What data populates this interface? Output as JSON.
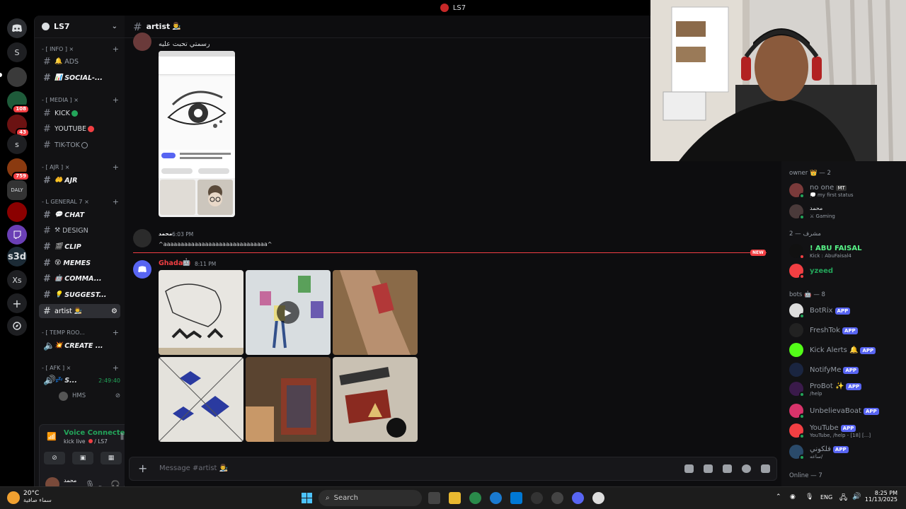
{
  "window": {
    "title": "LS7"
  },
  "rail": {
    "servers": [
      {
        "name": "discord-home-icon",
        "label": "",
        "badge": ""
      },
      {
        "name": "server-s-1",
        "label": "S",
        "badge": ""
      },
      {
        "name": "server-a",
        "label": "",
        "badge": ""
      },
      {
        "name": "server-b",
        "label": "",
        "badge": "108"
      },
      {
        "name": "server-c",
        "label": "",
        "badge": "43"
      },
      {
        "name": "server-s-2",
        "label": "s",
        "badge": ""
      },
      {
        "name": "server-d",
        "label": "",
        "badge": "759"
      },
      {
        "name": "server-daly",
        "label": "DALY",
        "badge": ""
      },
      {
        "name": "server-e",
        "label": "",
        "badge": ""
      },
      {
        "name": "server-twitch",
        "label": "",
        "badge": ""
      },
      {
        "name": "server-s3d",
        "label": "s3d",
        "badge": ""
      },
      {
        "name": "server-xs",
        "label": "Xs",
        "badge": ""
      }
    ]
  },
  "guild": {
    "name": "LS7"
  },
  "sidebar": {
    "categories": [
      {
        "label": "- [ INFO ] ×",
        "top": 0
      },
      {
        "label": "- [ MEDIA ] ×",
        "top": 0
      },
      {
        "label": "- [ AJR ] ×",
        "top": 0
      },
      {
        "label": "- L GENERAL 7 ×",
        "top": 0
      },
      {
        "label": "- [ TEMP ROO...",
        "top": 0
      },
      {
        "label": "- [ AFK ] ×",
        "top": 0
      }
    ],
    "channels": {
      "ads": "ADS",
      "social": "SOCIAL-...",
      "kick": "KICK",
      "youtube": "YOUTUBE",
      "tiktok": "TIK-TOK",
      "ajr": "AJR",
      "chat": "CHAT",
      "design": "DESIGN",
      "clip": "CLIP",
      "memes": "MEMES",
      "commands": "COMMA...",
      "suggest": "SUGGEST...",
      "artist": "artist",
      "create": "CREATE ...",
      "afk_voice": "S...",
      "afk_time": "2:49:40",
      "afk_user": "HMS"
    }
  },
  "voice": {
    "status": "Voice Connected",
    "channel": "kick live",
    "guild": "/ LS7"
  },
  "user": {
    "name": "محمد"
  },
  "channel": {
    "name": "artist"
  },
  "messages": [
    {
      "text": "رسمتي تحبت عليه"
    },
    {
      "author": "محمد",
      "time": "6:03 PM",
      "text": "^aaaaaaaaaaaaaaaaaaaaaaaaaaaaaa^"
    },
    {
      "author": "Ghada",
      "time": "8:11 PM"
    }
  ],
  "new_label": "NEW",
  "composer": {
    "placeholder": "Message #artist"
  },
  "members": {
    "groups": {
      "owner": "owner 👑 — 2",
      "mod": "2 — مشرف",
      "bots": "bots 🤖 — 8",
      "online": "Online — 7"
    },
    "owner": [
      {
        "name": "no one",
        "tag": "MT",
        "status": "my first status"
      },
      {
        "name": "محمد",
        "status": "Gaming"
      }
    ],
    "mods": [
      {
        "name": "! ABU FAISAL",
        "status": "Kick : AbuFaisal4"
      },
      {
        "name": "yzeed",
        "status": ""
      }
    ],
    "bots": [
      {
        "name": "BotRix",
        "status": ""
      },
      {
        "name": "FreshTok",
        "status": ""
      },
      {
        "name": "Kick Alerts",
        "status": ""
      },
      {
        "name": "NotifyMe",
        "status": ""
      },
      {
        "name": "ProBot",
        "status": "/help"
      },
      {
        "name": "UnbelievaBoat",
        "status": ""
      },
      {
        "name": "YouTube",
        "status": "YouTube, /help - [18] [...]"
      },
      {
        "name": "فلكوني",
        "status": "ساعه/"
      }
    ],
    "app_label": "APP"
  },
  "taskbar": {
    "temp": "20°C",
    "weather": "سماء صافية",
    "search": "Search",
    "lang": "ENG",
    "time": "8:25 PM",
    "date": "11/13/2025"
  },
  "colors": {
    "accent": "#5865f2",
    "online": "#23a55a",
    "danger": "#f23f43",
    "ghada": "#f23f43",
    "yzeed": "#23a55a",
    "abu": "#57f287"
  }
}
